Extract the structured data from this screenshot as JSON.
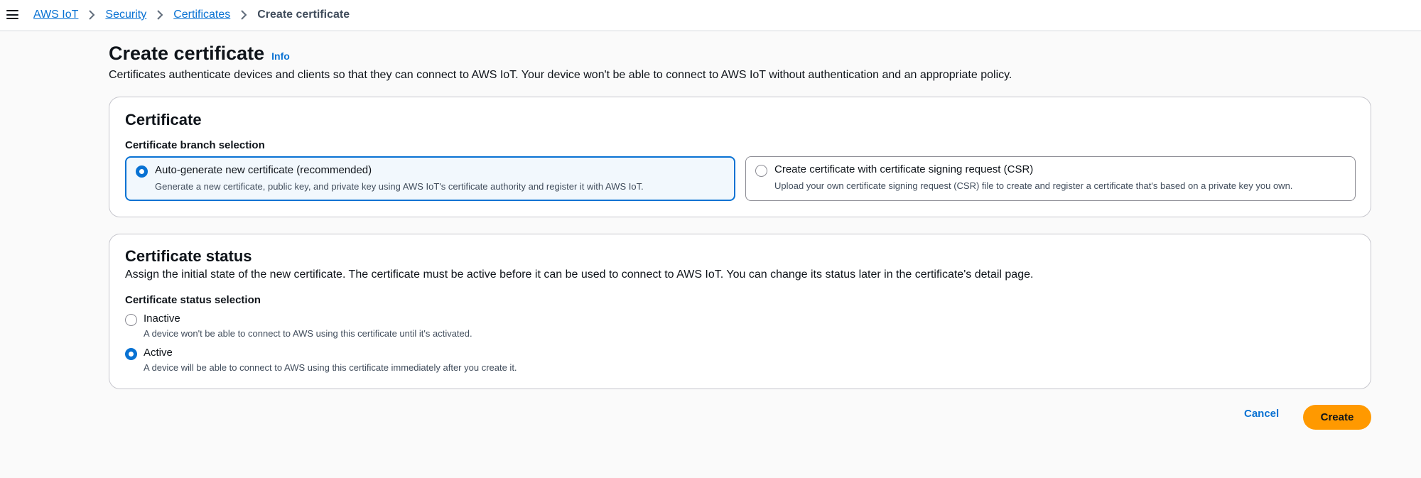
{
  "breadcrumb": {
    "items": [
      "AWS IoT",
      "Security",
      "Certificates"
    ],
    "current": "Create certificate"
  },
  "page": {
    "title": "Create certificate",
    "info": "Info",
    "description": "Certificates authenticate devices and clients so that they can connect to AWS IoT. Your device won't be able to connect to AWS IoT without authentication and an appropriate policy."
  },
  "certificate": {
    "title": "Certificate",
    "branch_label": "Certificate branch selection",
    "options": [
      {
        "label": "Auto-generate new certificate (recommended)",
        "description": "Generate a new certificate, public key, and private key using AWS IoT's certificate authority and register it with AWS IoT.",
        "selected": true
      },
      {
        "label": "Create certificate with certificate signing request (CSR)",
        "description": "Upload your own certificate signing request (CSR) file to create and register a certificate that's based on a private key you own.",
        "selected": false
      }
    ]
  },
  "status": {
    "title": "Certificate status",
    "description": "Assign the initial state of the new certificate. The certificate must be active before it can be used to connect to AWS IoT. You can change its status later in the certificate's detail page.",
    "selection_label": "Certificate status selection",
    "options": [
      {
        "label": "Inactive",
        "description": "A device won't be able to connect to AWS using this certificate until it's activated.",
        "selected": false
      },
      {
        "label": "Active",
        "description": "A device will be able to connect to AWS using this certificate immediately after you create it.",
        "selected": true
      }
    ]
  },
  "actions": {
    "cancel": "Cancel",
    "create": "Create"
  },
  "colors": {
    "link": "#0972d3",
    "primary_button": "#ff9900",
    "selected_tile_bg": "#f2f8fd"
  },
  "icons": {
    "menu": "hamburger-menu-icon",
    "separator": "chevron-right-icon"
  }
}
